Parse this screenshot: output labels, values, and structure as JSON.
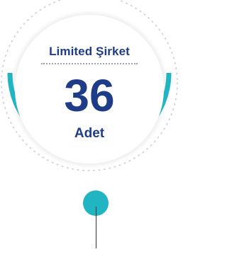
{
  "badge": {
    "title": "Limited Şirket",
    "count": "36",
    "unit": "Adet"
  },
  "colors": {
    "primary": "#1f3c88",
    "accent": "#21b5c4",
    "circle_fill": "#ffffff",
    "dotted_ring": "#c9ced8"
  }
}
